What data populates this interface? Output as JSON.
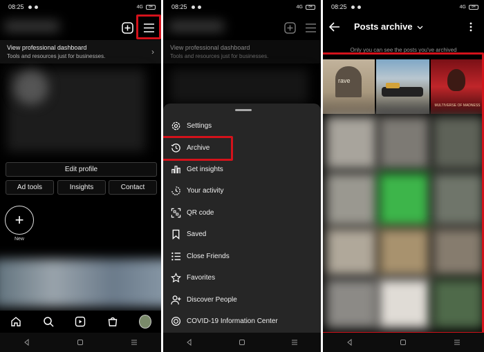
{
  "status_bar": {
    "time": "08:25",
    "network": "4G",
    "battery": "84"
  },
  "screen1": {
    "dashboard_title": "View professional dashboard",
    "dashboard_subtitle": "Tools and resources just for businesses.",
    "edit_profile": "Edit profile",
    "ad_tools": "Ad tools",
    "insights": "Insights",
    "contact": "Contact",
    "new_label": "New",
    "new_plus": "+",
    "chevron": "›"
  },
  "screen2": {
    "dashboard_title": "View professional dashboard",
    "dashboard_subtitle": "Tools and resources just for businesses.",
    "menu": [
      {
        "label": "Settings",
        "icon": "settings-icon"
      },
      {
        "label": "Archive",
        "icon": "archive-icon"
      },
      {
        "label": "Get insights",
        "icon": "insights-icon"
      },
      {
        "label": "Your activity",
        "icon": "activity-icon"
      },
      {
        "label": "QR code",
        "icon": "qr-code-icon"
      },
      {
        "label": "Saved",
        "icon": "saved-icon"
      },
      {
        "label": "Close Friends",
        "icon": "close-friends-icon"
      },
      {
        "label": "Favorites",
        "icon": "favorites-icon"
      },
      {
        "label": "Discover People",
        "icon": "discover-people-icon"
      },
      {
        "label": "COVID-19 Information Center",
        "icon": "covid-info-icon"
      }
    ]
  },
  "screen3": {
    "title": "Posts archive",
    "note": "Only you can see the posts you've archived",
    "thumb_text_1": "rave",
    "thumb_text_3": "MULTIVERSE OF MADNESS"
  },
  "colors": {
    "highlight": "#d4121b",
    "background": "#000000",
    "sheet": "#262626"
  }
}
